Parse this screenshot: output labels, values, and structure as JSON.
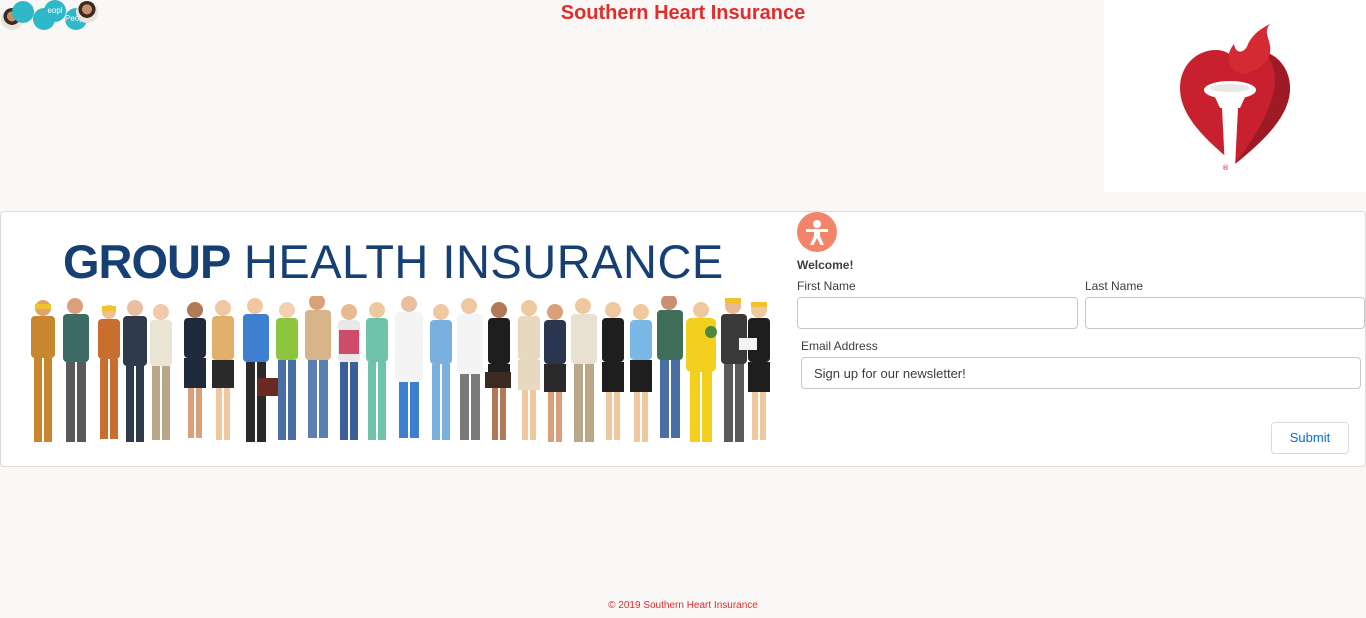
{
  "header": {
    "title": "Southern Heart Insurance",
    "avatars": [
      {
        "icon": "profile-photo",
        "text": ""
      },
      {
        "icon": "people-group",
        "text": ""
      },
      {
        "icon": "people-group",
        "text": ""
      },
      {
        "icon": "people-group",
        "text": "eopl"
      },
      {
        "icon": "people-group",
        "text": "People"
      },
      {
        "icon": "profile-photo",
        "text": ""
      }
    ]
  },
  "logo": {
    "icon": "heart-torch-logo",
    "color": "#c9202f"
  },
  "banner": {
    "heading_bold": "GROUP",
    "heading_light": "HEALTH INSURANCE",
    "heading_color": "#163f73",
    "image": "group-of-diverse-workers"
  },
  "form": {
    "welcome_icon": "person-icon",
    "welcome_icon_color": "#f0856a",
    "welcome": "Welcome!",
    "first_name_label": "First Name",
    "first_name_value": "",
    "last_name_label": "Last Name",
    "last_name_value": "",
    "email_label": "Email Address",
    "email_placeholder": "Sign up for our newsletter!",
    "submit_label": "Submit",
    "submit_color": "#0070d2"
  },
  "footer": {
    "text": "© 2019 Southern Heart Insurance"
  },
  "colors": {
    "accent": "#e32c2c",
    "avatar": "#2fb8c8",
    "background": "#f9f8f7"
  }
}
